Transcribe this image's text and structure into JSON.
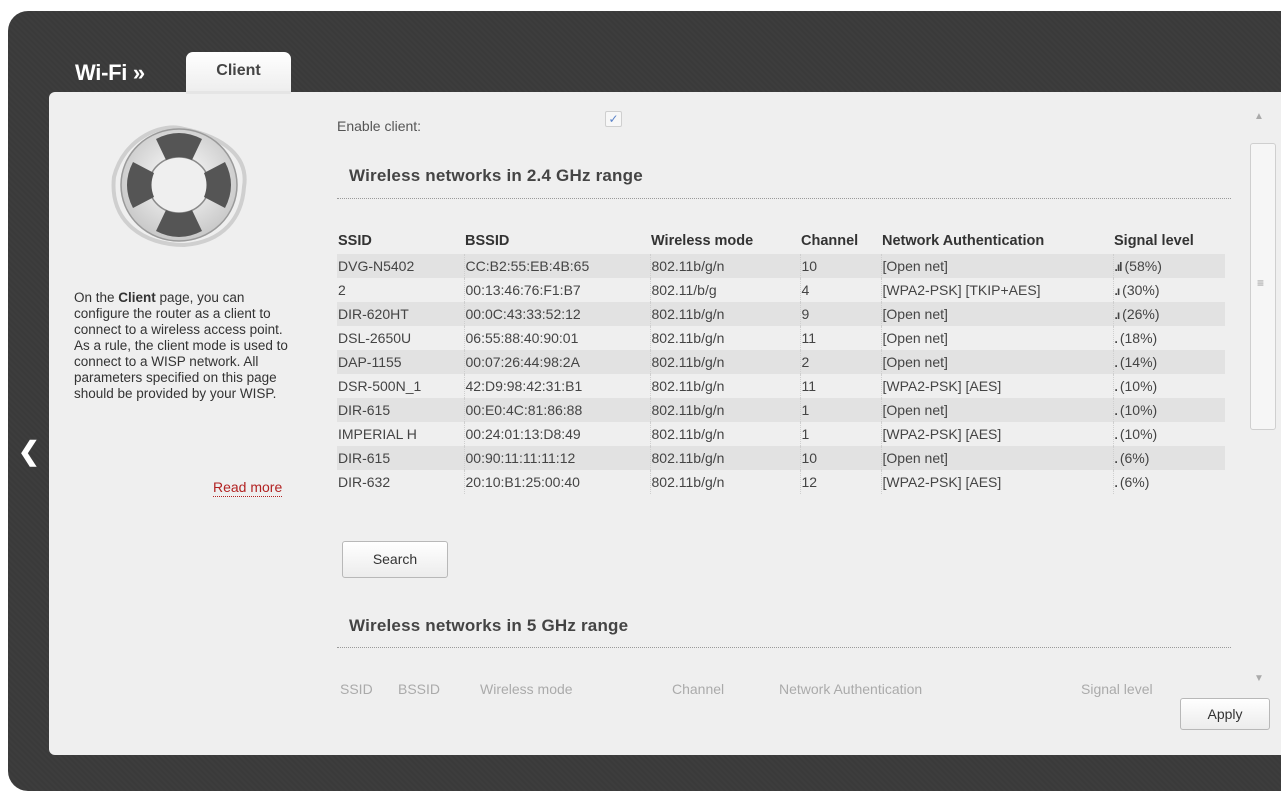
{
  "header": {
    "section": "Wi-Fi »",
    "tab": "Client"
  },
  "sidebar": {
    "help_prefix": "On the ",
    "help_bold": "Client",
    "help_rest": " page, you can configure the router as a client to connect to a wireless access point.",
    "help_line2": "As a rule, the client mode is used to connect to a WISP network. All parameters specified on this page should be provided by your WISP.",
    "read_more": "Read more"
  },
  "form": {
    "enable_label": "Enable client:",
    "enable_checked": true,
    "check_glyph": "✓"
  },
  "section_24": {
    "title": "Wireless networks in 2.4 GHz range"
  },
  "section_5": {
    "title": "Wireless networks in 5 GHz range"
  },
  "table": {
    "headers": [
      "SSID",
      "BSSID",
      "Wireless mode",
      "Channel",
      "Network Authentication",
      "Signal level"
    ],
    "rows": [
      {
        "ssid": "DVG-N5402",
        "bssid": "CC:B2:55:EB:4B:65",
        "mode": "802.11b/g/n",
        "channel": "10",
        "auth": "[Open net]",
        "bars": ".ıl",
        "signal": "(58%)"
      },
      {
        "ssid": "2",
        "bssid": "00:13:46:76:F1:B7",
        "mode": "802.11/b/g",
        "channel": "4",
        "auth": "[WPA2-PSK] [TKIP+AES]",
        "bars": ".ı",
        "signal": "(30%)"
      },
      {
        "ssid": "DIR-620HT",
        "bssid": "00:0C:43:33:52:12",
        "mode": "802.11b/g/n",
        "channel": "9",
        "auth": "[Open net]",
        "bars": ".ı",
        "signal": "(26%)"
      },
      {
        "ssid": "DSL-2650U",
        "bssid": "06:55:88:40:90:01",
        "mode": "802.11b/g/n",
        "channel": "11",
        "auth": "[Open net]",
        "bars": ".",
        "signal": "(18%)"
      },
      {
        "ssid": "DAP-1155",
        "bssid": "00:07:26:44:98:2A",
        "mode": "802.11b/g/n",
        "channel": "2",
        "auth": "[Open net]",
        "bars": ".",
        "signal": "(14%)"
      },
      {
        "ssid": "DSR-500N_1",
        "bssid": "42:D9:98:42:31:B1",
        "mode": "802.11b/g/n",
        "channel": "11",
        "auth": "[WPA2-PSK] [AES]",
        "bars": ".",
        "signal": "(10%)"
      },
      {
        "ssid": "DIR-615",
        "bssid": "00:E0:4C:81:86:88",
        "mode": "802.11b/g/n",
        "channel": "1",
        "auth": "[Open net]",
        "bars": ".",
        "signal": "(10%)"
      },
      {
        "ssid": "IMPERIAL H",
        "bssid": "00:24:01:13:D8:49",
        "mode": "802.11b/g/n",
        "channel": "1",
        "auth": "[WPA2-PSK] [AES]",
        "bars": ".",
        "signal": "(10%)"
      },
      {
        "ssid": "DIR-615",
        "bssid": "00:90:11:11:11:12",
        "mode": "802.11b/g/n",
        "channel": "10",
        "auth": "[Open net]",
        "bars": ".",
        "signal": "(6%)"
      },
      {
        "ssid": "DIR-632",
        "bssid": "20:10:B1:25:00:40",
        "mode": "802.11b/g/n",
        "channel": "12",
        "auth": "[WPA2-PSK] [AES]",
        "bars": ".",
        "signal": "(6%)"
      }
    ]
  },
  "table5_headers": [
    "SSID",
    "BSSID",
    "Wireless mode",
    "Channel",
    "Network Authentication",
    "Signal level"
  ],
  "buttons": {
    "search": "Search",
    "apply": "Apply"
  },
  "icons": {
    "back": "chevron-left-icon",
    "lifebuoy": "lifebuoy-icon",
    "scroll_up": "▲",
    "scroll_grip": "≡",
    "scroll_down": "▼",
    "back_glyph": "❮"
  },
  "colors": {
    "frame": "#3a3a3a",
    "panel": "#efefef",
    "read_more": "#b22222",
    "row_stripe": "#e2e2e2"
  }
}
